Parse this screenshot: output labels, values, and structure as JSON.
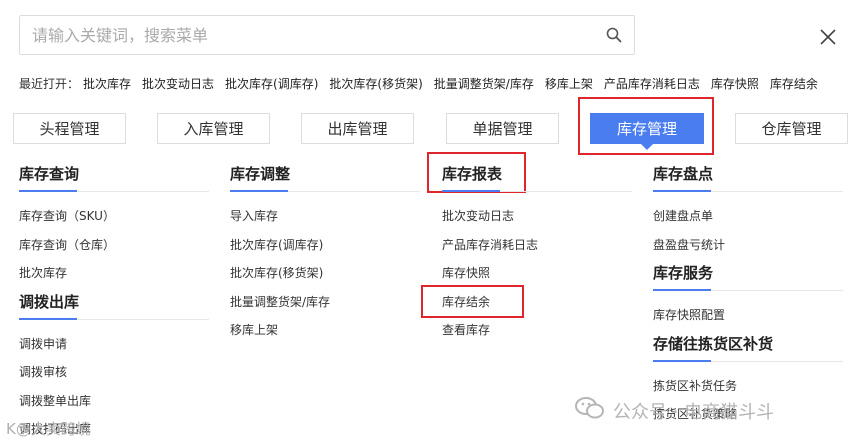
{
  "search": {
    "placeholder": "请输入关键词，搜索菜单"
  },
  "recent": {
    "label": "最近打开：",
    "items": [
      "批次库存",
      "批次变动日志",
      "批次库存(调库存)",
      "批次库存(移货架)",
      "批量调整货架/库存",
      "移库上架",
      "产品库存消耗日志",
      "库存快照",
      "库存结余"
    ]
  },
  "tabs": [
    {
      "label": "头程管理",
      "active": false
    },
    {
      "label": "入库管理",
      "active": false
    },
    {
      "label": "出库管理",
      "active": false
    },
    {
      "label": "单据管理",
      "active": false
    },
    {
      "label": "库存管理",
      "active": true
    },
    {
      "label": "仓库管理",
      "active": false
    }
  ],
  "columns": [
    {
      "groups": [
        {
          "title": "库存查询",
          "items": [
            "库存查询（SKU）",
            "库存查询（仓库）",
            "批次库存"
          ]
        },
        {
          "title": "调拨出库",
          "items": [
            "调拨申请",
            "调拨审核",
            "调拨整单出库",
            "调拨打码出库"
          ]
        }
      ]
    },
    {
      "groups": [
        {
          "title": "库存调整",
          "items": [
            "导入库存",
            "批次库存(调库存)",
            "批次库存(移货架)",
            "批量调整货架/库存",
            "移库上架"
          ]
        }
      ]
    },
    {
      "groups": [
        {
          "title": "库存报表",
          "items": [
            "批次变动日志",
            "产品库存消耗日志",
            "库存快照",
            "库存结余",
            "查看库存"
          ]
        }
      ]
    },
    {
      "groups": [
        {
          "title": "库存盘点",
          "items": [
            "创建盘点单",
            "盘盈盘亏统计"
          ]
        },
        {
          "title": "库存服务",
          "items": [
            "库存快照配置"
          ]
        },
        {
          "title": "存储往拣货区补货",
          "items": [
            "拣货区补货任务",
            "拣货区补货策略"
          ]
        }
      ]
    }
  ],
  "watermarks": {
    "right": "公众号 · 电商猫斗斗",
    "left": "K@大卖跨境"
  },
  "colors": {
    "accent": "#4a7df0",
    "highlight": "#e0262c"
  },
  "icons": {
    "search": "search-icon",
    "close": "close-icon",
    "wechat": "wechat-icon"
  }
}
